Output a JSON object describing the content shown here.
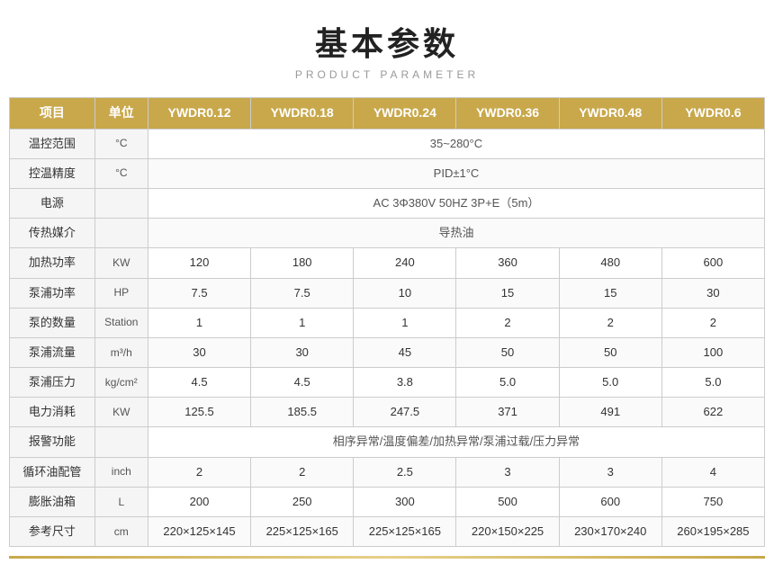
{
  "title": {
    "zh": "基本参数",
    "en": "PRODUCT PARAMETER"
  },
  "table": {
    "headers": [
      "项目",
      "单位",
      "YWDR0.12",
      "YWDR0.18",
      "YWDR0.24",
      "YWDR0.36",
      "YWDR0.48",
      "YWDR0.6"
    ],
    "rows": [
      {
        "label": "温控范围",
        "unit": "°C",
        "span": true,
        "spanValue": "35~280°C",
        "cells": []
      },
      {
        "label": "控温精度",
        "unit": "°C",
        "span": true,
        "spanValue": "PID±1°C",
        "cells": []
      },
      {
        "label": "电源",
        "unit": "",
        "span": true,
        "spanValue": "AC 3Φ380V 50HZ 3P+E（5m）",
        "cells": []
      },
      {
        "label": "传热媒介",
        "unit": "",
        "span": true,
        "spanValue": "导热油",
        "cells": []
      },
      {
        "label": "加热功率",
        "unit": "KW",
        "span": false,
        "spanValue": "",
        "cells": [
          "120",
          "180",
          "240",
          "360",
          "480",
          "600"
        ]
      },
      {
        "label": "泵浦功率",
        "unit": "HP",
        "span": false,
        "spanValue": "",
        "cells": [
          "7.5",
          "7.5",
          "10",
          "15",
          "15",
          "30"
        ]
      },
      {
        "label": "泵的数量",
        "unit": "Station",
        "span": false,
        "spanValue": "",
        "cells": [
          "1",
          "1",
          "1",
          "2",
          "2",
          "2"
        ]
      },
      {
        "label": "泵浦流量",
        "unit": "m³/h",
        "span": false,
        "spanValue": "",
        "cells": [
          "30",
          "30",
          "45",
          "50",
          "50",
          "100"
        ]
      },
      {
        "label": "泵浦压力",
        "unit": "kg/cm²",
        "span": false,
        "spanValue": "",
        "cells": [
          "4.5",
          "4.5",
          "3.8",
          "5.0",
          "5.0",
          "5.0"
        ]
      },
      {
        "label": "电力消耗",
        "unit": "KW",
        "span": false,
        "spanValue": "",
        "cells": [
          "125.5",
          "185.5",
          "247.5",
          "371",
          "491",
          "622"
        ]
      },
      {
        "label": "报警功能",
        "unit": "",
        "span": true,
        "spanValue": "相序异常/温度偏差/加热异常/泵浦过载/压力异常",
        "cells": []
      },
      {
        "label": "循环油配管",
        "unit": "inch",
        "span": false,
        "spanValue": "",
        "cells": [
          "2",
          "2",
          "2.5",
          "3",
          "3",
          "4"
        ]
      },
      {
        "label": "膨胀油箱",
        "unit": "L",
        "span": false,
        "spanValue": "",
        "cells": [
          "200",
          "250",
          "300",
          "500",
          "600",
          "750"
        ]
      },
      {
        "label": "参考尺寸",
        "unit": "cm",
        "span": false,
        "spanValue": "",
        "cells": [
          "220×125×145",
          "225×125×165",
          "225×125×165",
          "220×150×225",
          "230×170×240",
          "260×195×285"
        ]
      }
    ]
  }
}
